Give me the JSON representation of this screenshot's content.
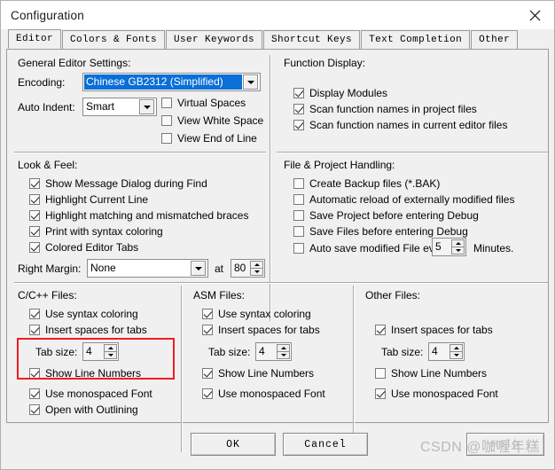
{
  "window": {
    "title": "Configuration",
    "close_icon": "close-icon"
  },
  "tabs": [
    {
      "label": "Editor",
      "selected": true
    },
    {
      "label": "Colors & Fonts",
      "selected": false
    },
    {
      "label": "User Keywords",
      "selected": false
    },
    {
      "label": "Shortcut Keys",
      "selected": false
    },
    {
      "label": "Text Completion",
      "selected": false
    },
    {
      "label": "Other",
      "selected": false
    }
  ],
  "general_editor": {
    "title": "General Editor Settings:",
    "encoding_label": "Encoding:",
    "encoding_value": "Chinese GB2312 (Simplified)",
    "auto_indent_label": "Auto Indent:",
    "auto_indent_value": "Smart",
    "options": [
      {
        "label": "Virtual Spaces",
        "checked": false
      },
      {
        "label": "View White Space",
        "checked": false
      },
      {
        "label": "View End of Line",
        "checked": false
      }
    ]
  },
  "look_feel": {
    "title": "Look & Feel:",
    "options": [
      {
        "label": "Show Message Dialog during Find",
        "checked": true
      },
      {
        "label": "Highlight Current Line",
        "checked": true
      },
      {
        "label": "Highlight matching and mismatched braces",
        "checked": true
      },
      {
        "label": "Print with syntax coloring",
        "checked": true
      },
      {
        "label": "Colored Editor Tabs",
        "checked": true
      }
    ],
    "right_margin_label": "Right Margin:",
    "right_margin_value": "None",
    "at_label": "at",
    "at_value": "80"
  },
  "function_display": {
    "title": "Function Display:",
    "options": [
      {
        "label": "Display Modules",
        "checked": true
      },
      {
        "label": "Scan function names in project files",
        "checked": true
      },
      {
        "label": "Scan function names in current editor files",
        "checked": true
      }
    ]
  },
  "file_project": {
    "title": "File & Project Handling:",
    "options": [
      {
        "label": "Create Backup files (*.BAK)",
        "checked": false
      },
      {
        "label": "Automatic reload of externally modified files",
        "checked": false
      },
      {
        "label": "Save Project before entering Debug",
        "checked": false
      },
      {
        "label": "Save Files before entering Debug",
        "checked": false
      },
      {
        "label": "Auto save modified File every",
        "checked": false
      }
    ],
    "autosave_value": "5",
    "minutes_label": "Minutes."
  },
  "cpp_files": {
    "title": "C/C++ Files:",
    "opt_syntax": {
      "label": "Use syntax coloring",
      "checked": true
    },
    "opt_spaces": {
      "label": "Insert spaces for tabs",
      "checked": true
    },
    "tabsize_label": "Tab size:",
    "tabsize_value": "4",
    "opt_linenum": {
      "label": "Show Line Numbers",
      "checked": true
    },
    "opt_mono": {
      "label": "Use monospaced Font",
      "checked": true
    },
    "opt_outline": {
      "label": "Open with Outlining",
      "checked": true
    }
  },
  "asm_files": {
    "title": "ASM Files:",
    "opt_syntax": {
      "label": "Use syntax coloring",
      "checked": true
    },
    "opt_spaces": {
      "label": "Insert spaces for tabs",
      "checked": true
    },
    "tabsize_label": "Tab size:",
    "tabsize_value": "4",
    "opt_linenum": {
      "label": "Show Line Numbers",
      "checked": true
    },
    "opt_mono": {
      "label": "Use monospaced Font",
      "checked": true
    }
  },
  "other_files": {
    "title": "Other Files:",
    "opt_spaces": {
      "label": "Insert spaces for tabs",
      "checked": true
    },
    "tabsize_label": "Tab size:",
    "tabsize_value": "4",
    "opt_linenum": {
      "label": "Show Line Numbers",
      "checked": false
    },
    "opt_mono": {
      "label": "Use monospaced Font",
      "checked": true
    }
  },
  "buttons": {
    "ok": "OK",
    "cancel": "Cancel",
    "help": "Help"
  },
  "watermark": "CSDN @咖喱年糕",
  "highlight": {
    "accent_color": "#ee1c24"
  }
}
